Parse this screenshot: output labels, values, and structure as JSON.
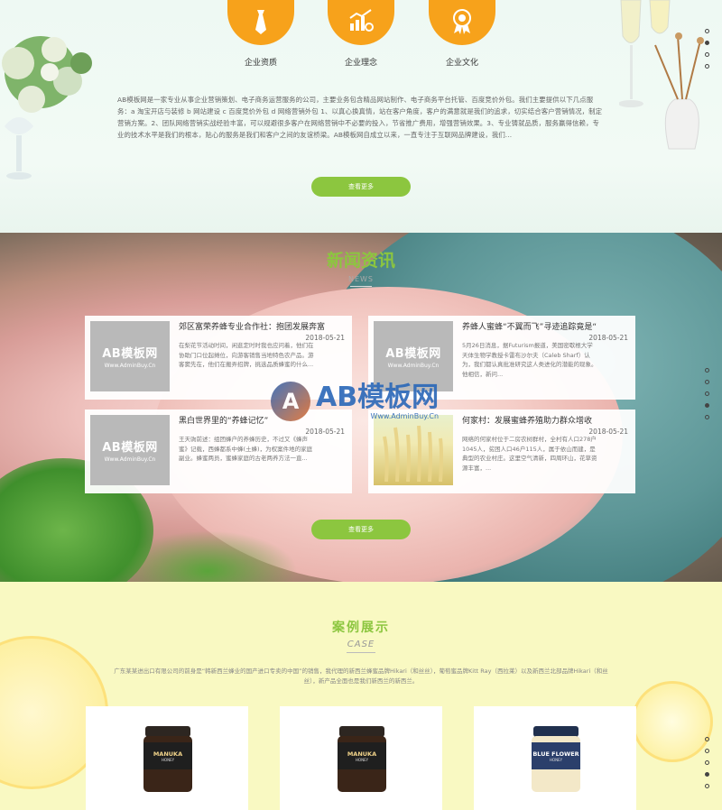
{
  "about": {
    "features": [
      {
        "label": "企业资质",
        "icon": "tie-icon"
      },
      {
        "label": "企业理念",
        "icon": "chart-gear-icon"
      },
      {
        "label": "企业文化",
        "icon": "medal-icon"
      }
    ],
    "text": "AB模板网是一家专业从事企业营销策划、电子商务运营服务的公司，主要业务包含精品网站制作、电子商务平台托管、百度竞价外包。我们主要提供以下几点服务：a 淘宝开店与装修 b 网站建设 c 百度竞价外包 d 网络营销外包 1、以真心换真情，站在客户角度，客户的满意就是我们的追求，切实结合客户营销情况，制定营销方案。2、团队网络营销实战经验丰富，可以规避很多客户在网络营销中不必要的投入，节省推广费用，增强营销效果。3、专业铸就品质，服务赢得信赖，专业的技术水平是我们的根本，贴心的服务是我们和客户之间的友谊桥梁。AB模板网自成立以来，一直专注于互联网品牌建设，我们...",
    "more_button": "查看更多"
  },
  "news": {
    "title": "新闻资讯",
    "subtitle": "NEWS",
    "more_button": "查看更多",
    "items": [
      {
        "title": "郊区富荣养蜂专业合作社：抱团发展奔富",
        "date": "2018-05-21",
        "desc": "在梨花节活动时间，闲逛定时时我也应问着，他们在协助门口位起摊位，向游客销售当地特色农产品。游客窦先在，他们在搬弄招牌，挑选品质蜂蜜的什么...",
        "thumb_title": "AB模板网",
        "thumb_url": "Www.AdminBuy.Cn"
      },
      {
        "title": "养蜂人蜜蜂“不翼而飞”寻迹追踪竟是“",
        "date": "2018-05-21",
        "desc": "5月26日消息，据Futurism报道，美国密歇根大学天体生物学教授卡雷布沙尔夫（Caleb Sharf）认为，我们都认真批准研究这人类进化的潜能的现象。他相信，新问...",
        "thumb_title": "AB模板网",
        "thumb_url": "Www.AdminBuy.Cn"
      },
      {
        "title": "黑白世界里的“养蜂记忆”",
        "date": "2018-05-21",
        "desc": "王天驹前述：组团蜂户的养蜂历史，不过又《蜂声蜜》记载，西蜂都系中蜂(土蜂)，为权案件地的家庭副业。蜂蜜两员，蜜蜂家庭的古老两养方法一直...",
        "thumb_title": "AB模板网",
        "thumb_url": "Www.AdminBuy.Cn"
      },
      {
        "title": "何家村：发展蜜蜂养殖助力群众增收",
        "date": "2018-05-21",
        "desc": "网络的何家村位于二房农树群村，全村有人口278户1045人，贫困人口46户115人，属于依山而建，是典型的农业村庄。这里空气清新，四周环山，花草资源丰富，...",
        "thumb_title": "",
        "thumb_url": ""
      }
    ],
    "watermark": {
      "main": "AB模板网",
      "url": "Www.AdminBuy.Cn"
    }
  },
  "cases": {
    "title": "案例展示",
    "subtitle": "CASE",
    "intro": "广东某某进出口有限公司的前身是“韩新西兰蜂业的国产进口专卖的中国”的销售，我代理的新西兰蜂蜜品牌Hikari（和丝丝），葡萄蜜品牌Kitt Ray（西拉莱）以及新西兰北部品牌Hikari（和丝丝），新产品全面也是我们新西兰的新西兰。",
    "products": [
      {
        "label": "MANUKA",
        "sub": "HONEY",
        "style": "dark"
      },
      {
        "label": "MANUKA",
        "sub": "HONEY",
        "style": "dark"
      },
      {
        "label": "BLUE FLOWER",
        "sub": "HONEY",
        "style": "light"
      }
    ]
  },
  "colors": {
    "accent_green": "#8cc63f",
    "accent_orange": "#f7a21b",
    "case_bg": "#f9f9c2"
  }
}
